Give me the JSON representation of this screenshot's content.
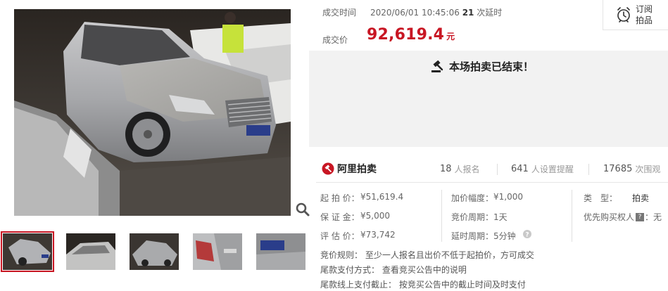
{
  "deal": {
    "time_label": "成交时间",
    "time_value": "2020/06/01 10:45:06",
    "delay_count": "21",
    "delay_suffix": "次延时",
    "price_label": "成交价",
    "price_value": "92,619.4",
    "price_unit": "元"
  },
  "subscribe": {
    "label_line1": "订阅",
    "label_line2": "拍品"
  },
  "status": {
    "message": "本场拍卖已结束！"
  },
  "brand": {
    "name": "阿里拍卖"
  },
  "stats": [
    {
      "num": "18",
      "unit": "人报名"
    },
    {
      "num": "641",
      "unit": "人设置提醒"
    },
    {
      "num": "17685",
      "unit": "次围观"
    }
  ],
  "info": {
    "start_price_label": "起 拍 价：",
    "start_price": "¥51,619.4",
    "deposit_label": "保 证 金：",
    "deposit": "¥5,000",
    "assess_label": "评 估 价：",
    "assess": "¥73,742",
    "increment_label": "加价幅度：",
    "increment": "¥1,000",
    "cycle_label": "竞价周期：",
    "cycle": "1天",
    "delay_label": "延时周期：",
    "delay": "5分钟",
    "type_label": "类　型：",
    "type": "拍卖",
    "priority_label": "优先购买权人",
    "priority_badge": "?",
    "priority_value": "：无"
  },
  "rules": {
    "bid_rule": "竞价规则： 至少一人报名且出价不低于起拍价，方可成交",
    "payment_method": "尾款支付方式： 查看竞买公告中的说明",
    "online_deadline": "尾款线上支付截止： 按竞买公告中的截止时间及时支付"
  },
  "colors": {
    "accent": "#c81623",
    "panel_gray": "#f2f2f2"
  },
  "icons": [
    "zoom-icon",
    "alarm-clock-icon",
    "gavel-icon",
    "ali-auction-logo-icon",
    "help-icon"
  ]
}
